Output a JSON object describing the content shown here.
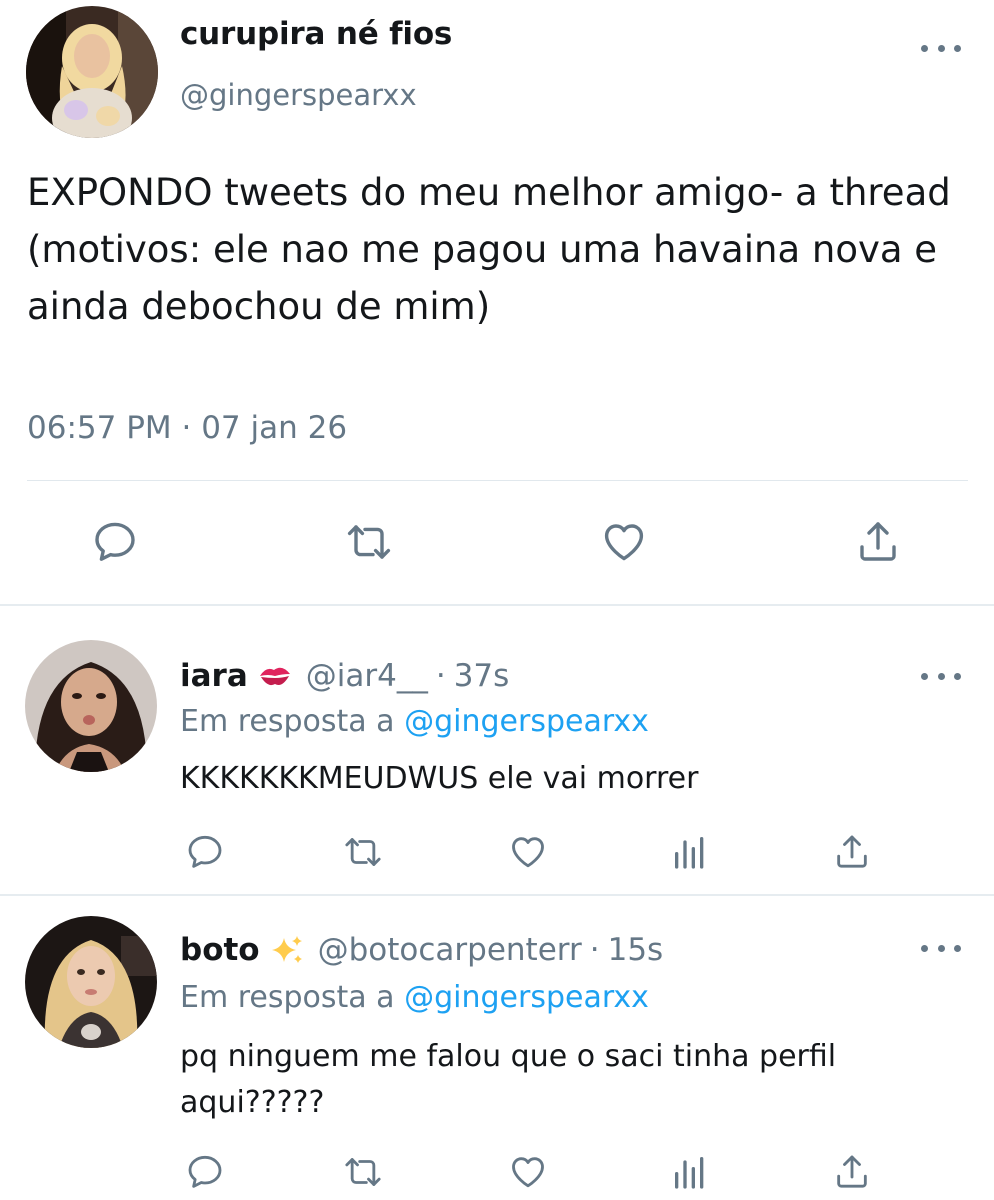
{
  "main_tweet": {
    "display_name": "curupira né fios",
    "handle": "@gingerspearxx",
    "text": "EXPONDO tweets do meu melhor amigo- a thread\n(motivos: ele nao me pagou uma havaina nova e ainda debochou de mim)",
    "timestamp": "06:57 PM · 07 jan 26",
    "actions": [
      "reply-icon",
      "retweet-icon",
      "like-icon",
      "share-icon"
    ]
  },
  "replies": [
    {
      "display_name": "iara",
      "emoji": "kiss-mark-icon",
      "handle": "@iar4__",
      "separator": "·",
      "time": "37s",
      "in_reply_prefix": "Em resposta a",
      "in_reply_mention": "@gingerspearxx",
      "text": "KKKKKKKMEUDWUS ele vai morrer",
      "actions": [
        "reply-icon",
        "retweet-icon",
        "like-icon",
        "analytics-icon",
        "share-icon"
      ]
    },
    {
      "display_name": "boto",
      "emoji": "sparkles-icon",
      "handle": "@botocarpenterr",
      "separator": "·",
      "time": "15s",
      "in_reply_prefix": "Em resposta a",
      "in_reply_mention": "@gingerspearxx",
      "text": "pq ninguem me falou que o saci tinha perfil aqui?????",
      "actions": [
        "reply-icon",
        "retweet-icon",
        "like-icon",
        "analytics-icon",
        "share-icon"
      ]
    }
  ],
  "colors": {
    "text_primary": "#14171a",
    "text_secondary": "#657786",
    "link": "#1da1f2",
    "divider": "#e1e8ed",
    "kiss_red": "#e0245e",
    "sparkle_gold": "#ffcc4d"
  }
}
